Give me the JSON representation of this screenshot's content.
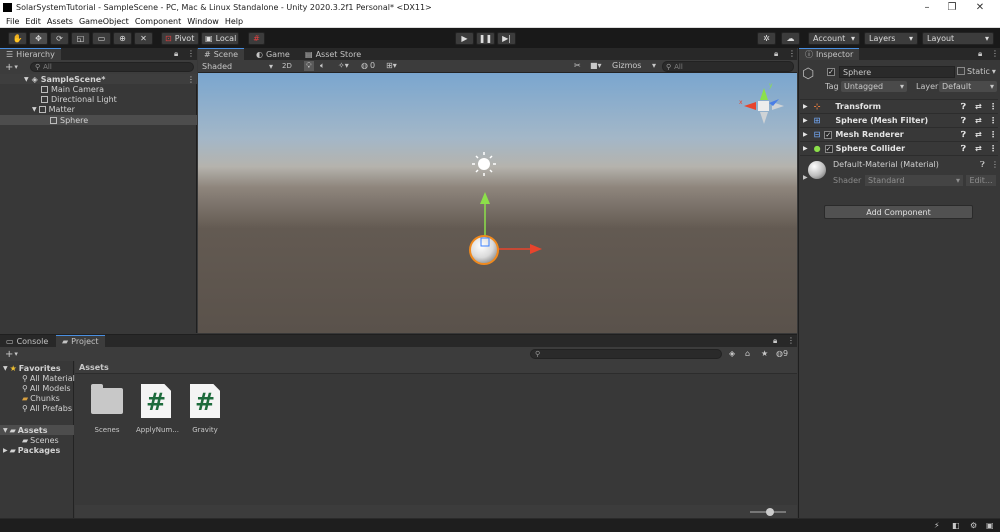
{
  "window": {
    "title": "SolarSystemTutorial - SampleScene - PC, Mac & Linux Standalone - Unity 2020.3.2f1 Personal* <DX11>",
    "controls": [
      "–",
      "❐",
      "✕"
    ]
  },
  "menu": [
    "File",
    "Edit",
    "Assets",
    "GameObject",
    "Component",
    "Window",
    "Help"
  ],
  "toolbar": {
    "pivot_label": "Pivot",
    "local_label": "Local",
    "account_label": "Account",
    "layers_label": "Layers",
    "layout_label": "Layout"
  },
  "hierarchy": {
    "tab_label": "Hierarchy",
    "search_placeholder": "All",
    "scene_name": "SampleScene*",
    "items": [
      "Main Camera",
      "Directional Light",
      "Matter",
      "Sphere"
    ]
  },
  "scene_tabs": [
    "Scene",
    "Game",
    "Asset Store"
  ],
  "scene_toolbar": {
    "shading": "Shaded",
    "mode_2d": "2D",
    "fx_count": "0",
    "gizmos_label": "Gizmos",
    "search_placeholder": "All"
  },
  "inspector": {
    "tab_label": "Inspector",
    "object_name": "Sphere",
    "static_label": "Static",
    "tag_label": "Tag",
    "tag_value": "Untagged",
    "layer_label": "Layer",
    "layer_value": "Default",
    "components": [
      "Transform",
      "Sphere (Mesh Filter)",
      "Mesh Renderer",
      "Sphere Collider"
    ],
    "material_name": "Default-Material (Material)",
    "shader_label": "Shader",
    "shader_value": "Standard",
    "edit_label": "Edit...",
    "add_component_label": "Add Component"
  },
  "project": {
    "tabs": [
      "Console",
      "Project"
    ],
    "favorites_label": "Favorites",
    "favorites": [
      "All Material",
      "All Models",
      "Chunks",
      "All Prefabs"
    ],
    "assets_label": "Assets",
    "assets_children": [
      "Scenes"
    ],
    "packages_label": "Packages",
    "breadcrumb": "Assets",
    "files": [
      "Scenes",
      "ApplyNum...",
      "Gravity"
    ],
    "hidden_count": "9"
  }
}
